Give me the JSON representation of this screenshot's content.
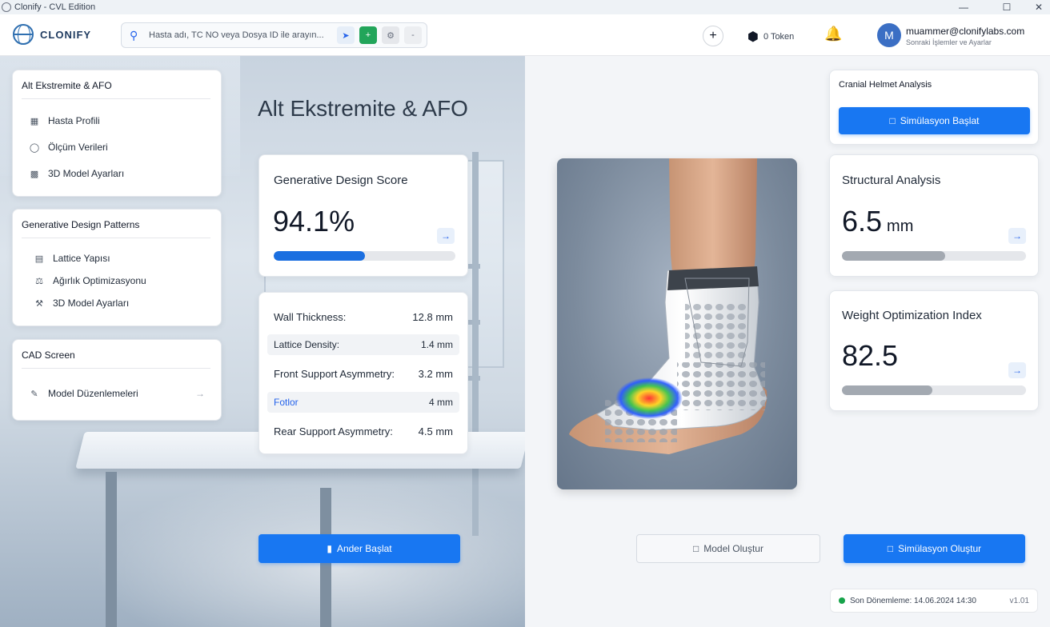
{
  "window": {
    "title": "Clonify - CVL Edition",
    "minimize": "—",
    "maximize": "☐",
    "close": "✕"
  },
  "header": {
    "brand": "CLONIFY",
    "search_placeholder": "Hasta adı, TC NO veya Dosya ID ile arayın...",
    "search_icon": "search-icon",
    "token_label": "0 Token",
    "user_initial": "M",
    "user_email": "muammer@clonifylabs.com",
    "user_subtitle": "Sonraki İşlemler ve Ayarlar"
  },
  "sidebar": {
    "group1": {
      "title": "Alt Ekstremite & AFO",
      "items": [
        {
          "label": "Hasta Profili",
          "icon": "profile-icon"
        },
        {
          "label": "Ölçüm Verileri",
          "icon": "measure-icon"
        },
        {
          "label": "3D Model Ayarları",
          "icon": "model-icon"
        }
      ]
    },
    "group2": {
      "title": "Generative Design Patterns",
      "items": [
        {
          "label": "Lattice Yapısı",
          "icon": "lattice-icon"
        },
        {
          "label": "Ağırlık Optimizasyonu",
          "icon": "weight-icon"
        },
        {
          "label": "3D Model Ayarları",
          "icon": "wrench-icon"
        }
      ]
    },
    "group3": {
      "title": "CAD Screen",
      "items": [
        {
          "label": "Model Düzenlemeleri",
          "icon": "edit-icon"
        }
      ]
    }
  },
  "main": {
    "page_title": "Alt Ekstremite & AFO",
    "score_card": {
      "label": "Generative Design Score",
      "value": "94.1%",
      "progress": 0.5
    },
    "specs": [
      {
        "key": "Wall Thickness:",
        "value": "12.8 mm",
        "style": "plain"
      },
      {
        "key": "Lattice Density:",
        "value": "1.4 mm",
        "style": "shaded"
      },
      {
        "key": "Front Support Asymmetry:",
        "value": "3.2 mm",
        "style": "plain"
      },
      {
        "key": "Fotlor",
        "value": "4 mm",
        "style": "link"
      },
      {
        "key": "Rear Support Asymmetry:",
        "value": "4.5 mm",
        "style": "plain"
      }
    ],
    "start_button": "Ander Başlat"
  },
  "right": {
    "cranial": {
      "title": "Cranial Helmet Analysis",
      "button": "Simülasyon Başlat"
    },
    "structural": {
      "label": "Structural Analysis",
      "value": "6.5",
      "unit": "mm",
      "progress": 0.56
    },
    "weight": {
      "label": "Weight Optimization Index",
      "value": "82.5",
      "progress": 0.49
    },
    "model_button": "Model Oluştur",
    "sim_button": "Simülasyon Oluştur",
    "status_text": "Son Dönemleme: 14.06.2024 14:30",
    "version": "v1.01"
  },
  "colors": {
    "primary": "#1877f2",
    "progress_primary": "#1b6fe0",
    "progress_gray": "#a3a9b1"
  }
}
